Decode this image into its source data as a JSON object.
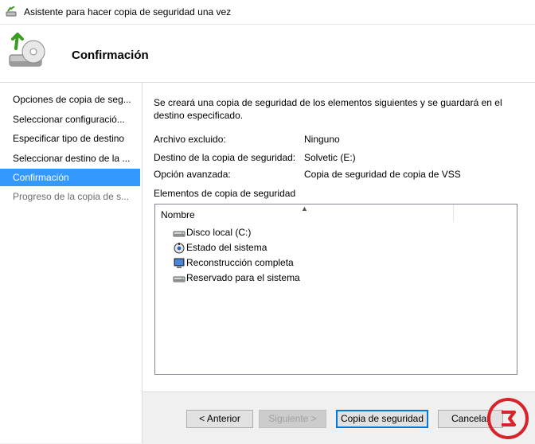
{
  "window": {
    "title": "Asistente para hacer copia de seguridad una vez"
  },
  "header": {
    "heading": "Confirmación"
  },
  "sidebar": {
    "items": [
      {
        "label": "Opciones de copia de seg..."
      },
      {
        "label": "Seleccionar configuració..."
      },
      {
        "label": "Especificar tipo de destino"
      },
      {
        "label": "Seleccionar destino de la ..."
      },
      {
        "label": "Confirmación"
      },
      {
        "label": "Progreso de la copia de s..."
      }
    ]
  },
  "content": {
    "description": "Se creará una copia de seguridad de los elementos siguientes y se guardará en el destino especificado.",
    "details": [
      {
        "label": "Archivo excluido:",
        "value": "Ninguno"
      },
      {
        "label": "Destino de la copia de seguridad:",
        "value": "Solvetic (E:)"
      },
      {
        "label": "Opción avanzada:",
        "value": "Copia de seguridad de copia de VSS"
      }
    ],
    "items_label": "Elementos de copia de seguridad",
    "list": {
      "column_header": "Nombre",
      "rows": [
        {
          "label": "Disco local (C:)",
          "icon": "drive-icon"
        },
        {
          "label": "Estado del sistema",
          "icon": "system-state-icon"
        },
        {
          "label": "Reconstrucción completa",
          "icon": "computer-icon"
        },
        {
          "label": "Reservado para el sistema",
          "icon": "drive-icon"
        }
      ]
    }
  },
  "footer": {
    "back_label": "< Anterior",
    "next_label": "Siguiente >",
    "backup_label": "Copia de seguridad",
    "cancel_label": "Cancelar"
  },
  "colors": {
    "accent": "#3399ff",
    "primary_border": "#0078d7",
    "watermark": "#d8232a"
  }
}
